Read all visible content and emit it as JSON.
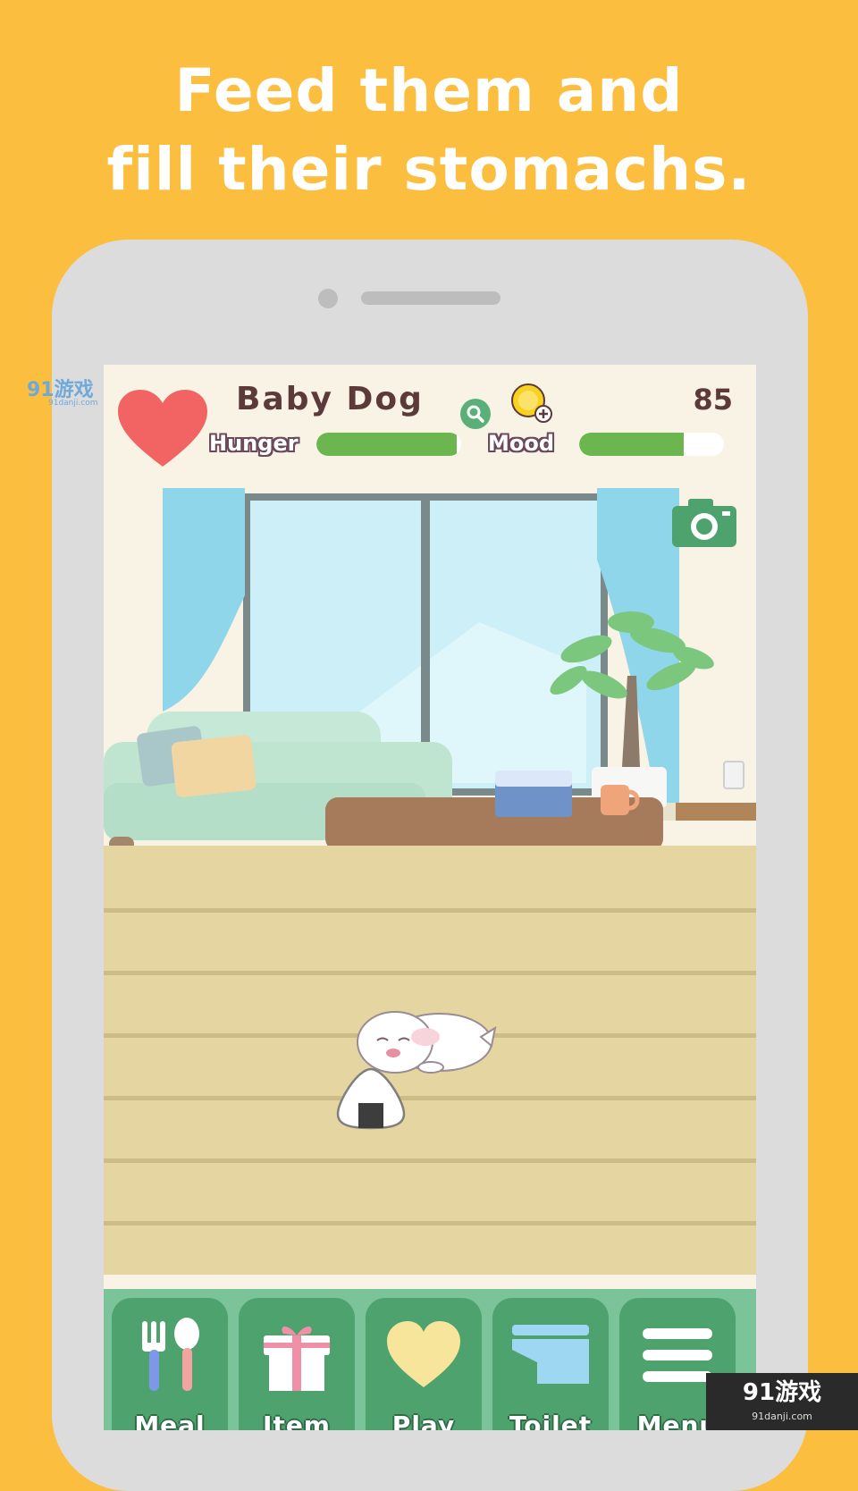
{
  "headline": {
    "line1": "Feed them and",
    "line2": "fill their stomachs."
  },
  "pet": {
    "name": "Baby Dog",
    "coins": "85",
    "hunger_label": "Hunger",
    "hunger_level": 0.97,
    "mood_label": "Mood",
    "mood_level": 0.72
  },
  "menu": {
    "items": [
      {
        "label": "Meal",
        "icon": "fork-spoon-icon"
      },
      {
        "label": "Item",
        "icon": "gift-icon"
      },
      {
        "label": "Play",
        "icon": "heart-icon"
      },
      {
        "label": "Toilet",
        "icon": "toilet-icon"
      },
      {
        "label": "Menu",
        "icon": "hamburger-icon"
      }
    ]
  },
  "watermarks": {
    "top_left": "91游戏",
    "top_left_url": "91danji.com",
    "bottom_right": "91游戏",
    "bottom_right_url": "91danji.com"
  },
  "colors": {
    "background": "#FBBE3F",
    "accent_green": "#4EA26E",
    "bar_green": "#6BB64E",
    "heart_red": "#F26464"
  }
}
